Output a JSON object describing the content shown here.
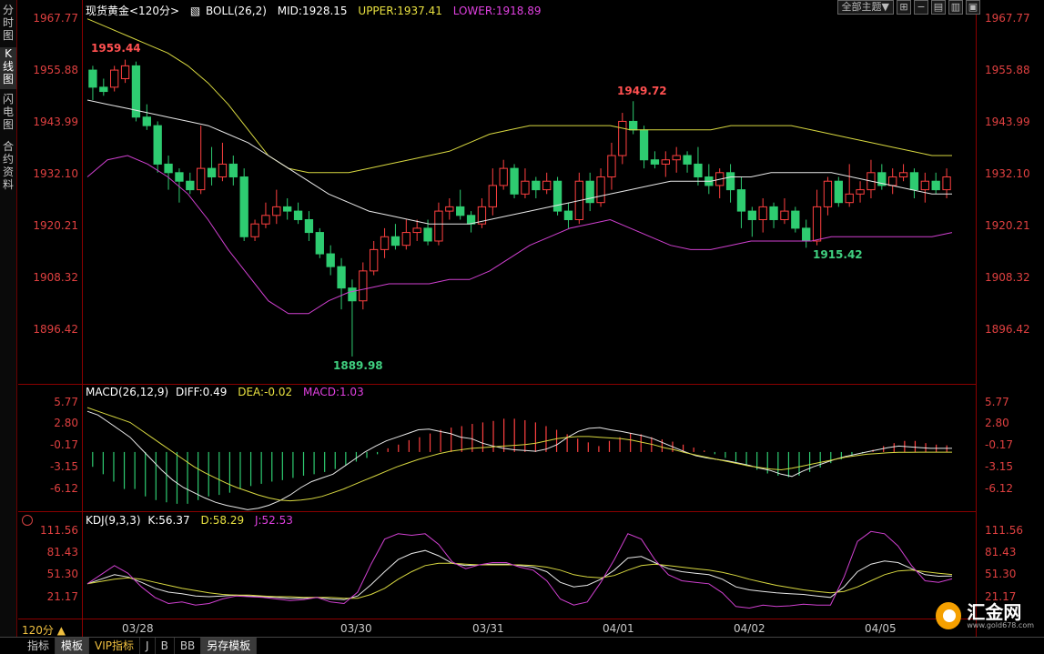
{
  "side_tabs": [
    {
      "label": "分时图",
      "active": false
    },
    {
      "label": "K线图",
      "active": true
    },
    {
      "label": "闪电图",
      "active": false
    },
    {
      "label": "合约资料",
      "active": false
    }
  ],
  "toolbar": {
    "theme_select": "全部主题▼",
    "icons": [
      "grid-icon",
      "minus-icon",
      "layout-icon",
      "layout-icon",
      "layout-icon"
    ]
  },
  "main": {
    "instrument": "现货黄金<120分>",
    "boll": "BOLL(26,2)",
    "mid": "MID:1928.15",
    "upper": "UPPER:1937.41",
    "lower": "LOWER:1918.89",
    "y_labels": [
      "1967.77",
      "1955.88",
      "1943.99",
      "1932.10",
      "1920.21",
      "1908.32",
      "1896.42"
    ],
    "annotations": {
      "high1": "1959.44",
      "high2": "1949.72",
      "low1": "1889.98",
      "low2": "1915.42"
    }
  },
  "macd": {
    "label": "MACD(26,12,9)",
    "diff": "DIFF:0.49",
    "dea": "DEA:-0.02",
    "macd": "MACD:1.03",
    "y_labels": [
      "5.77",
      "2.80",
      "-0.17",
      "-3.15",
      "-6.12"
    ]
  },
  "kdj": {
    "label": "KDJ(9,3,3)",
    "k": "K:56.37",
    "d": "D:58.29",
    "j": "J:52.53",
    "y_labels": [
      "111.56",
      "81.43",
      "51.30",
      "21.17"
    ]
  },
  "x_labels": [
    "03/28",
    "03/30",
    "03/31",
    "04/01",
    "04/02",
    "04/05"
  ],
  "period": "120分 ▲",
  "bottom_tabs": [
    {
      "label": "指标",
      "active": false
    },
    {
      "label": "模板",
      "active": true
    },
    {
      "label": "VIP指标",
      "active": false
    },
    {
      "label": "J",
      "active": false
    },
    {
      "label": "B",
      "active": false
    },
    {
      "label": "BB",
      "active": false
    },
    {
      "label": "另存模板",
      "active": true
    }
  ],
  "logo": {
    "name": "汇金网",
    "url": "www.gold678.com"
  },
  "colors": {
    "up": "#ff4040",
    "down": "#2ecc71",
    "mid": "#e8e8e8",
    "upper": "#d8d840",
    "lower": "#d040d0",
    "axis": "#e04040"
  },
  "chart_data": [
    {
      "type": "candlestick",
      "title": "现货黄金<120分>",
      "ylim": [
        1884,
        1970
      ],
      "candles": [
        [
          1957,
          1953,
          1958,
          1950
        ],
        [
          1953,
          1952,
          1955,
          1951
        ],
        [
          1953,
          1957,
          1958,
          1952
        ],
        [
          1955,
          1958,
          1959.44,
          1954
        ],
        [
          1958,
          1946,
          1959,
          1945
        ],
        [
          1946,
          1944,
          1949,
          1943
        ],
        [
          1944,
          1935,
          1945,
          1933
        ],
        [
          1935,
          1933,
          1937,
          1929
        ],
        [
          1933,
          1931,
          1934,
          1926
        ],
        [
          1931,
          1929,
          1933,
          1928
        ],
        [
          1929,
          1934,
          1944,
          1928
        ],
        [
          1934,
          1932,
          1939,
          1930
        ],
        [
          1932,
          1935,
          1940,
          1931
        ],
        [
          1935,
          1932,
          1937,
          1930
        ],
        [
          1932,
          1918,
          1934,
          1917
        ],
        [
          1918,
          1921,
          1922,
          1917
        ],
        [
          1921,
          1923,
          1926,
          1920
        ],
        [
          1923,
          1925,
          1929,
          1921
        ],
        [
          1925,
          1924,
          1927,
          1922
        ],
        [
          1924,
          1922,
          1926,
          1921
        ],
        [
          1922,
          1919,
          1924,
          1917
        ],
        [
          1919,
          1914,
          1920,
          1913
        ],
        [
          1914,
          1911,
          1916,
          1909
        ],
        [
          1911,
          1906,
          1913,
          1901
        ],
        [
          1906,
          1903,
          1908,
          1889.98
        ],
        [
          1903,
          1910,
          1912,
          1901
        ],
        [
          1910,
          1915,
          1917,
          1909
        ],
        [
          1915,
          1918,
          1920,
          1913
        ],
        [
          1918,
          1916,
          1921,
          1915
        ],
        [
          1916,
          1919,
          1922,
          1915
        ],
        [
          1919,
          1920,
          1922,
          1917
        ],
        [
          1920,
          1917,
          1922,
          1916
        ],
        [
          1917,
          1924,
          1926,
          1916
        ],
        [
          1924,
          1925,
          1927,
          1922
        ],
        [
          1925,
          1923,
          1929,
          1922
        ],
        [
          1923,
          1921,
          1924,
          1919
        ],
        [
          1921,
          1925,
          1927,
          1920
        ],
        [
          1925,
          1930,
          1934,
          1923
        ],
        [
          1930,
          1934,
          1936,
          1929
        ],
        [
          1934,
          1928,
          1935,
          1927
        ],
        [
          1928,
          1931,
          1934,
          1927
        ],
        [
          1931,
          1929,
          1932,
          1927
        ],
        [
          1929,
          1931,
          1933,
          1928
        ],
        [
          1931,
          1924,
          1932,
          1923
        ],
        [
          1924,
          1922,
          1926,
          1920
        ],
        [
          1922,
          1931,
          1933,
          1921
        ],
        [
          1931,
          1926,
          1933,
          1924
        ],
        [
          1926,
          1932,
          1934,
          1925
        ],
        [
          1932,
          1937,
          1940,
          1929
        ],
        [
          1937,
          1945,
          1947,
          1935
        ],
        [
          1945,
          1943,
          1949.72,
          1942
        ],
        [
          1943,
          1936,
          1944,
          1934
        ],
        [
          1936,
          1935,
          1938,
          1934
        ],
        [
          1935,
          1936,
          1938,
          1932
        ],
        [
          1936,
          1937,
          1939,
          1933
        ],
        [
          1937,
          1935,
          1938,
          1933
        ],
        [
          1935,
          1932,
          1939,
          1930
        ],
        [
          1932,
          1930,
          1935,
          1928
        ],
        [
          1930,
          1933,
          1934,
          1927
        ],
        [
          1933,
          1929,
          1935,
          1926
        ],
        [
          1929,
          1924,
          1932,
          1920
        ],
        [
          1924,
          1922,
          1925,
          1918
        ],
        [
          1922,
          1925,
          1927,
          1919
        ],
        [
          1925,
          1922,
          1926,
          1920
        ],
        [
          1922,
          1924,
          1927,
          1921
        ],
        [
          1924,
          1920,
          1925,
          1919
        ],
        [
          1920,
          1917,
          1922,
          1915.42
        ],
        [
          1917,
          1925,
          1929,
          1916
        ],
        [
          1925,
          1931,
          1932,
          1923
        ],
        [
          1931,
          1926,
          1932,
          1925
        ],
        [
          1926,
          1928,
          1935,
          1925
        ],
        [
          1928,
          1929,
          1931,
          1926
        ],
        [
          1929,
          1933,
          1936,
          1927
        ],
        [
          1933,
          1930,
          1935,
          1929
        ],
        [
          1930,
          1932,
          1934,
          1928
        ],
        [
          1932,
          1933,
          1935,
          1931
        ],
        [
          1933,
          1929,
          1934,
          1927
        ],
        [
          1929,
          1931,
          1933,
          1926
        ],
        [
          1931,
          1929,
          1933,
          1928
        ],
        [
          1929,
          1932,
          1934,
          1927
        ]
      ],
      "boll_mid": [
        1950,
        1949,
        1948,
        1947,
        1946,
        1945,
        1944,
        1942,
        1940,
        1937,
        1934,
        1931,
        1928,
        1926,
        1924,
        1923,
        1922,
        1921,
        1921,
        1921,
        1922,
        1923,
        1924,
        1925,
        1926,
        1927,
        1928,
        1929,
        1930,
        1931,
        1931,
        1931,
        1932,
        1932,
        1933,
        1933,
        1933,
        1933,
        1932,
        1931,
        1930,
        1929,
        1928,
        1928
      ],
      "boll_upper": [
        1969,
        1967,
        1965,
        1963,
        1961,
        1958,
        1954,
        1949,
        1943,
        1937,
        1934,
        1933,
        1933,
        1933,
        1934,
        1935,
        1936,
        1937,
        1938,
        1940,
        1942,
        1943,
        1944,
        1944,
        1944,
        1944,
        1944,
        1943,
        1943,
        1943,
        1943,
        1943,
        1944,
        1944,
        1944,
        1944,
        1943,
        1942,
        1941,
        1940,
        1939,
        1938,
        1937,
        1937
      ],
      "boll_lower": [
        1932,
        1936,
        1937,
        1935,
        1932,
        1928,
        1922,
        1915,
        1909,
        1903,
        1900,
        1900,
        1903,
        1905,
        1906,
        1907,
        1907,
        1907,
        1908,
        1908,
        1910,
        1913,
        1916,
        1918,
        1920,
        1921,
        1922,
        1920,
        1918,
        1916,
        1915,
        1915,
        1916,
        1917,
        1917,
        1917,
        1917,
        1918,
        1918,
        1918,
        1918,
        1918,
        1918,
        1919
      ]
    },
    {
      "type": "bar",
      "title": "MACD(26,12,9)",
      "ylim": [
        -8,
        7
      ],
      "values": [
        -2,
        -3,
        -4,
        -5,
        -5,
        -6,
        -6.5,
        -6.8,
        -7,
        -7,
        -6.5,
        -6,
        -5.8,
        -5.5,
        -5,
        -4.6,
        -4.3,
        -4,
        -3.8,
        -3.5,
        -3.2,
        -3,
        -2.7,
        -2.3,
        -1.8,
        -1.3,
        -0.8,
        -0.3,
        0.5,
        1,
        1.6,
        2,
        2.5,
        3,
        3.3,
        3.5,
        3.8,
        4,
        4.2,
        4.5,
        4.5,
        4.3,
        4,
        3.5,
        3,
        2.4,
        1.8,
        1.3,
        0.8,
        1.5,
        2,
        2.6,
        2.4,
        2,
        1.7,
        1.4,
        1,
        0.6,
        0.2,
        -0.3,
        -0.8,
        -1.3,
        -1.9,
        -2.4,
        -2.9,
        -3.2,
        -3.4,
        -3.2,
        -2.7,
        -2.1,
        -1.5,
        -1,
        -0.5,
        -0.2,
        0.3,
        0.8,
        1.2,
        1.5,
        1.5,
        1.2,
        1,
        0.9
      ],
      "diff": [
        5.5,
        5,
        4,
        3,
        2,
        0.5,
        -1,
        -2.5,
        -3.8,
        -4.8,
        -5.5,
        -6.2,
        -6.8,
        -7.2,
        -7.5,
        -7.8,
        -7.6,
        -7.2,
        -6.6,
        -5.8,
        -4.8,
        -4,
        -3.5,
        -3,
        -2,
        -1,
        0,
        0.8,
        1.5,
        2,
        2.5,
        3,
        3.1,
        2.8,
        2.5,
        2,
        1.8,
        1.2,
        0.8,
        0.5,
        0.3,
        0.2,
        0.1,
        0.4,
        1,
        2,
        2.8,
        3.2,
        3.3,
        3,
        2.8,
        2.5,
        2.2,
        1.8,
        1.2,
        0.6,
        0,
        -0.5,
        -0.8,
        -1,
        -1.2,
        -1.5,
        -1.8,
        -2.2,
        -2.5,
        -3,
        -3.3,
        -2.6,
        -2,
        -1.5,
        -1,
        -0.6,
        -0.3,
        0,
        0.3,
        0.6,
        0.8,
        0.7,
        0.6,
        0.5,
        0.5,
        0.49
      ],
      "dea": [
        6,
        5.5,
        5,
        4.5,
        4,
        3,
        2,
        1,
        0,
        -1,
        -2,
        -2.8,
        -3.5,
        -4.2,
        -4.8,
        -5.3,
        -5.8,
        -6.2,
        -6.5,
        -6.6,
        -6.5,
        -6.3,
        -6,
        -5.5,
        -5,
        -4.4,
        -3.8,
        -3.2,
        -2.6,
        -2,
        -1.5,
        -1,
        -0.6,
        -0.2,
        0.1,
        0.3,
        0.5,
        0.6,
        0.7,
        0.8,
        0.9,
        1,
        1.2,
        1.5,
        1.8,
        2,
        2.1,
        2.1,
        2,
        1.9,
        1.8,
        1.6,
        1.3,
        1,
        0.6,
        0.3,
        -0.1,
        -0.4,
        -0.7,
        -1,
        -1.3,
        -1.6,
        -1.9,
        -2.1,
        -2.3,
        -2.4,
        -2.2,
        -1.9,
        -1.6,
        -1.3,
        -1,
        -0.7,
        -0.5,
        -0.3,
        -0.2,
        -0.1,
        -0.05,
        -0.03,
        -0.02,
        -0.02,
        -0.02,
        -0.02
      ]
    },
    {
      "type": "line",
      "title": "KDJ(9,3,3)",
      "ylim": [
        5,
        125
      ],
      "series": [
        {
          "name": "K",
          "values": [
            46,
            52,
            58,
            55,
            48,
            40,
            35,
            33,
            30,
            29,
            30,
            31,
            30,
            29,
            28,
            27,
            27,
            28,
            26,
            25,
            30,
            45,
            62,
            78,
            86,
            90,
            83,
            73,
            70,
            71,
            72,
            72,
            70,
            68,
            62,
            48,
            42,
            44,
            52,
            64,
            80,
            82,
            74,
            66,
            62,
            60,
            58,
            52,
            42,
            38,
            36,
            34,
            33,
            32,
            30,
            28,
            42,
            62,
            72,
            76,
            74,
            66,
            58,
            56,
            56.37
          ]
        },
        {
          "name": "D",
          "values": [
            46,
            49,
            52,
            54,
            52,
            48,
            44,
            40,
            37,
            34,
            32,
            31,
            31,
            30,
            29,
            29,
            28,
            28,
            28,
            27,
            27,
            32,
            40,
            52,
            62,
            70,
            73,
            73,
            72,
            71,
            71,
            71,
            71,
            70,
            68,
            64,
            58,
            55,
            54,
            57,
            64,
            70,
            72,
            70,
            68,
            66,
            64,
            61,
            57,
            52,
            48,
            44,
            41,
            38,
            36,
            34,
            36,
            42,
            50,
            58,
            63,
            64,
            62,
            60,
            58.29
          ]
        },
        {
          "name": "J",
          "values": [
            46,
            58,
            70,
            60,
            42,
            28,
            20,
            22,
            18,
            20,
            26,
            30,
            29,
            28,
            26,
            24,
            25,
            28,
            22,
            20,
            35,
            72,
            105,
            112,
            110,
            112,
            98,
            75,
            66,
            71,
            74,
            74,
            68,
            64,
            50,
            26,
            18,
            22,
            48,
            78,
            112,
            105,
            78,
            58,
            50,
            48,
            46,
            34,
            16,
            14,
            18,
            16,
            17,
            19,
            18,
            18,
            55,
            102,
            115,
            112,
            96,
            70,
            50,
            48,
            52.53
          ]
        }
      ]
    }
  ]
}
